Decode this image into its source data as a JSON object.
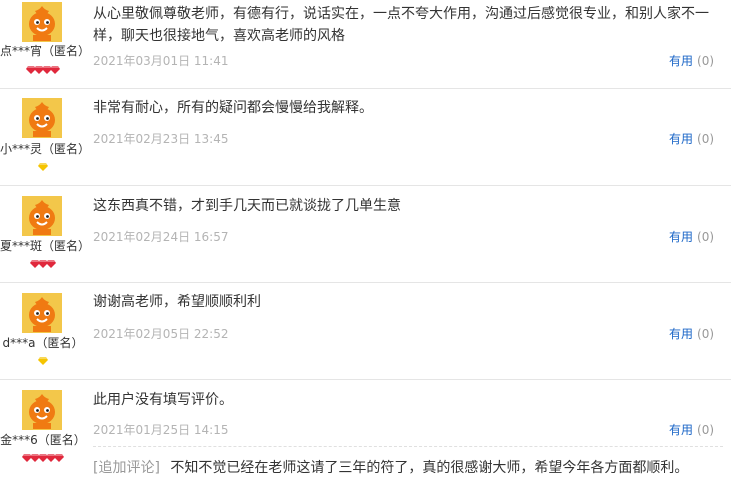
{
  "reviews": [
    {
      "user": "点***宵（匿名）",
      "content": "从心里敬佩尊敬老师，有德有行，说话实在，一点不夸大作用，沟通过后感觉很专业，和别人家不一样，聊天也很接地气，喜欢高老师的风格",
      "date": "2021年03月01日 11:41",
      "useful_label": "有用",
      "useful_count": "(0)",
      "badge_level": 4,
      "badge_kind": "red-diamond"
    },
    {
      "user": "小***灵（匿名）",
      "content": "非常有耐心，所有的疑问都会慢慢给我解释。",
      "date": "2021年02月23日 13:45",
      "useful_label": "有用",
      "useful_count": "(0)",
      "badge_level": 1,
      "badge_kind": "yellow-diamond"
    },
    {
      "user": "夏***斑（匿名）",
      "content": "这东西真不错，才到手几天而已就谈拢了几单生意",
      "date": "2021年02月24日 16:57",
      "useful_label": "有用",
      "useful_count": "(0)",
      "badge_level": 3,
      "badge_kind": "red-diamond"
    },
    {
      "user": "d***a（匿名）",
      "content": "谢谢高老师，希望顺顺利利",
      "date": "2021年02月05日 22:52",
      "useful_label": "有用",
      "useful_count": "(0)",
      "badge_level": 1,
      "badge_kind": "yellow-diamond"
    },
    {
      "user": "金***6（匿名）",
      "content": "此用户没有填写评价。",
      "date": "2021年01月25日 14:15",
      "useful_label": "有用",
      "useful_count": "(0)",
      "badge_level": 5,
      "badge_kind": "red-diamond"
    }
  ],
  "append_review": {
    "tag": "[追加评论]",
    "content": "不知不觉已经在老师这请了三年的符了，真的很感谢大师，希望今年各方面都顺利。"
  },
  "colors": {
    "link": "#1b66c7",
    "date": "#b4b4b4",
    "separator": "#e5e5e5",
    "red_diamond": "#e0283c",
    "yellow_diamond": "#f5c400",
    "avatar_bg": "#f3c74a",
    "avatar_face": "#f07a12"
  }
}
